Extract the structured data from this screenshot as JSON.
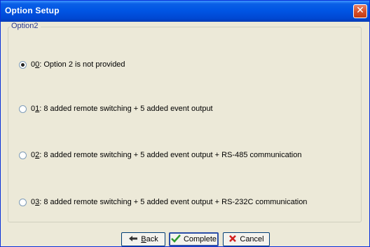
{
  "window": {
    "title": "Option Setup",
    "close_glyph": "✕"
  },
  "group": {
    "legend": "Option2"
  },
  "options": [
    {
      "code_prefix": "0",
      "code_key": "0",
      "text": ": Option 2 is not provided",
      "checked": true
    },
    {
      "code_prefix": "0",
      "code_key": "1",
      "text": ": 8 added remote switching + 5 added event output",
      "checked": false
    },
    {
      "code_prefix": "0",
      "code_key": "2",
      "text": ": 8 added remote switching + 5 added event output  + RS-485 communication",
      "checked": false
    },
    {
      "code_prefix": "0",
      "code_key": "3",
      "text": ": 8 added remote switching + 5 added event output  + RS-232C communication",
      "checked": false
    }
  ],
  "buttons": {
    "back": {
      "accel": "B",
      "rest": "ack",
      "icon": "back-arrow-icon"
    },
    "complete": {
      "label": "Complete",
      "icon": "checkmark-icon"
    },
    "cancel": {
      "label": "Cancel",
      "icon": "red-x-icon"
    }
  },
  "colors": {
    "titlebar": "#0054e3",
    "legend_text": "#2b3a8f",
    "checkmark": "#2e9a2e",
    "cancel_x": "#d22020"
  }
}
